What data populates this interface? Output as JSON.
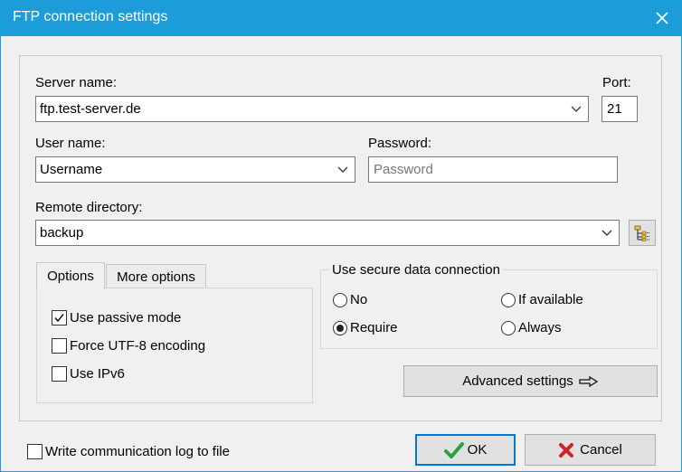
{
  "window": {
    "title": "FTP connection settings",
    "close_glyph": "✕"
  },
  "server": {
    "label": "Server name:",
    "value": "ftp.test-server.de"
  },
  "port": {
    "label": "Port:",
    "value": "21"
  },
  "user": {
    "label": "User name:",
    "value": "Username"
  },
  "password": {
    "label": "Password:",
    "placeholder": "Password"
  },
  "remote_dir": {
    "label": "Remote directory:",
    "value": "backup",
    "browse_icon": "folder-tree-icon"
  },
  "tabs": [
    {
      "label": "Options",
      "active": true
    },
    {
      "label": "More options",
      "active": false
    }
  ],
  "options": [
    {
      "label": "Use passive mode",
      "checked": true
    },
    {
      "label": "Force UTF-8 encoding",
      "checked": false
    },
    {
      "label": "Use IPv6",
      "checked": false
    }
  ],
  "secure": {
    "title": "Use secure data connection",
    "choices": [
      {
        "label": "No",
        "selected": false
      },
      {
        "label": "If available",
        "selected": false
      },
      {
        "label": "Require",
        "selected": true
      },
      {
        "label": "Always",
        "selected": false
      }
    ]
  },
  "advanced": {
    "label": "Advanced settings",
    "icon": "arrow-right-icon"
  },
  "log_to_file": {
    "label": "Write communication log to file",
    "checked": false
  },
  "ok": {
    "label": "OK",
    "icon": "checkmark-icon"
  },
  "cancel": {
    "label": "Cancel",
    "icon": "x-mark-icon"
  },
  "colors": {
    "titlebar": "#1c9cd8",
    "check_green": "#2ba23a",
    "cancel_red": "#d3202a"
  }
}
